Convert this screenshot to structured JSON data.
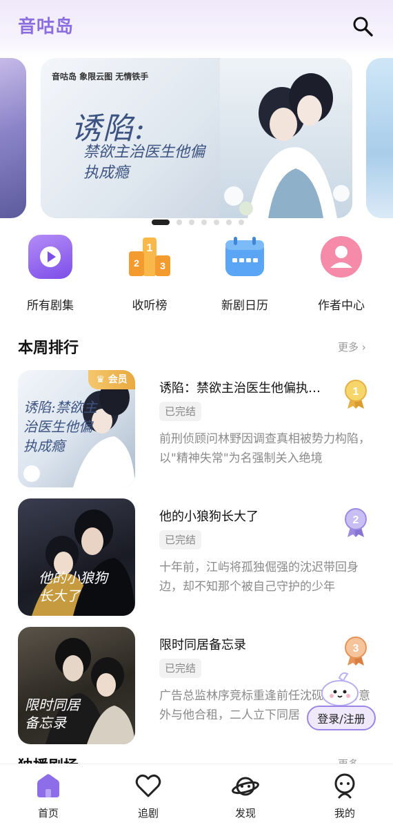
{
  "header": {
    "app_title": "音咕岛"
  },
  "banner": {
    "brand_line": "音咕岛  象限云图  无情铁手",
    "title": "诱陷:",
    "subtitle": "禁欲主治医生他偏执成瘾",
    "page_count": 7,
    "active_index": 0
  },
  "quick_nav": [
    {
      "label": "所有剧集",
      "icon": "play-icon",
      "color": "#8e63ee"
    },
    {
      "label": "收听榜",
      "icon": "podium-icon",
      "color": "#f6a43a"
    },
    {
      "label": "新剧日历",
      "icon": "calendar-icon",
      "color": "#4e9cf3"
    },
    {
      "label": "作者中心",
      "icon": "person-icon",
      "color": "#f06b92"
    }
  ],
  "weekly_rank": {
    "title": "本周排行",
    "more": "更多 ›",
    "items": [
      {
        "cover_title": "诱陷:禁欲主治医生他偏执成瘾",
        "badge": "会员",
        "name": "诱陷：禁欲主治医生他偏执成瘾",
        "status": "已完结",
        "desc": "前刑侦顾问林野因调查真相被势力构陷，以\"精神失常\"为名强制关入绝境",
        "rank": "1",
        "medal_color": "#f0c34e"
      },
      {
        "cover_title": "他的小狼狗长大了",
        "badge": "",
        "name": "他的小狼狗长大了",
        "status": "已完结",
        "desc": "十年前，江屿将孤独倔强的沈迟带回身边，却不知那个被自己守护的少年",
        "rank": "2",
        "medal_color": "#a698e6"
      },
      {
        "cover_title": "限时同居备忘录",
        "badge": "",
        "name": "限时同居备忘录",
        "status": "已完结",
        "desc": "广告总监林序竞标重逢前任沈砚，租房意外与他合租，二人立下同居",
        "rank": "3",
        "medal_color": "#f0a06a"
      }
    ]
  },
  "floating": {
    "login_label": "登录/注册"
  },
  "section2": {
    "title": "独播剧场",
    "more": "更多"
  },
  "tabbar": [
    {
      "label": "首页",
      "icon": "home-icon",
      "active": true
    },
    {
      "label": "追剧",
      "icon": "heart-icon",
      "active": false
    },
    {
      "label": "发现",
      "icon": "planet-icon",
      "active": false
    },
    {
      "label": "我的",
      "icon": "profile-icon",
      "active": false
    }
  ],
  "colors": {
    "accent": "#8b6fe0",
    "text": "#222222",
    "muted": "#8a8a8a"
  }
}
